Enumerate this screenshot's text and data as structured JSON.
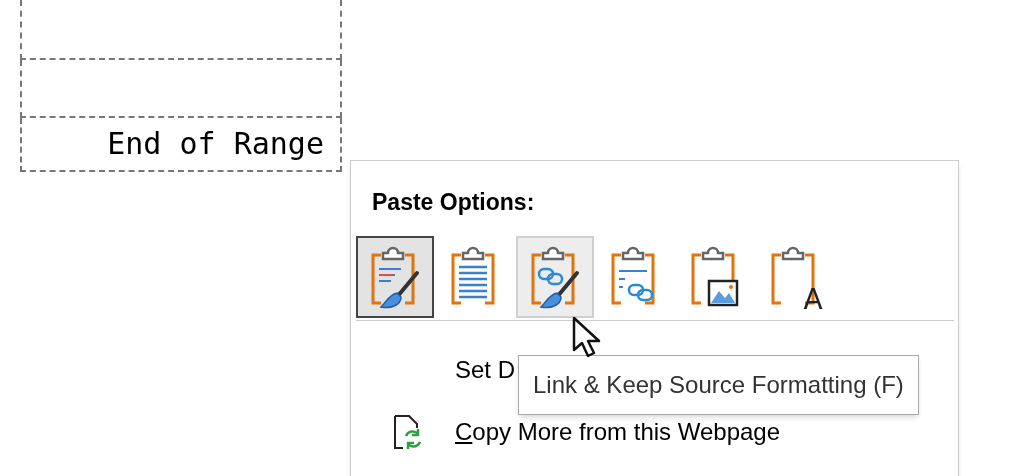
{
  "sheet": {
    "rows": [
      {
        "value": ""
      },
      {
        "value": ""
      },
      {
        "value": "End of Range"
      }
    ]
  },
  "context_menu": {
    "heading": "Paste Options:",
    "paste_options": [
      {
        "kind": "brush",
        "selected": true,
        "hovered": false
      },
      {
        "kind": "lines",
        "selected": false,
        "hovered": false
      },
      {
        "kind": "link_brush",
        "selected": false,
        "hovered": true
      },
      {
        "kind": "link",
        "selected": false,
        "hovered": false
      },
      {
        "kind": "picture",
        "selected": false,
        "hovered": false
      },
      {
        "kind": "text",
        "selected": false,
        "hovered": false,
        "glyph": "A"
      }
    ],
    "items": [
      {
        "label": "Set D",
        "kind": "plain",
        "access_key_underlined": false
      },
      {
        "label": "Copy More from this Webpage",
        "kind": "with_icon",
        "access_key_underlined": true
      }
    ]
  },
  "tooltip": {
    "text": "Link & Keep Source Formatting (F)"
  }
}
